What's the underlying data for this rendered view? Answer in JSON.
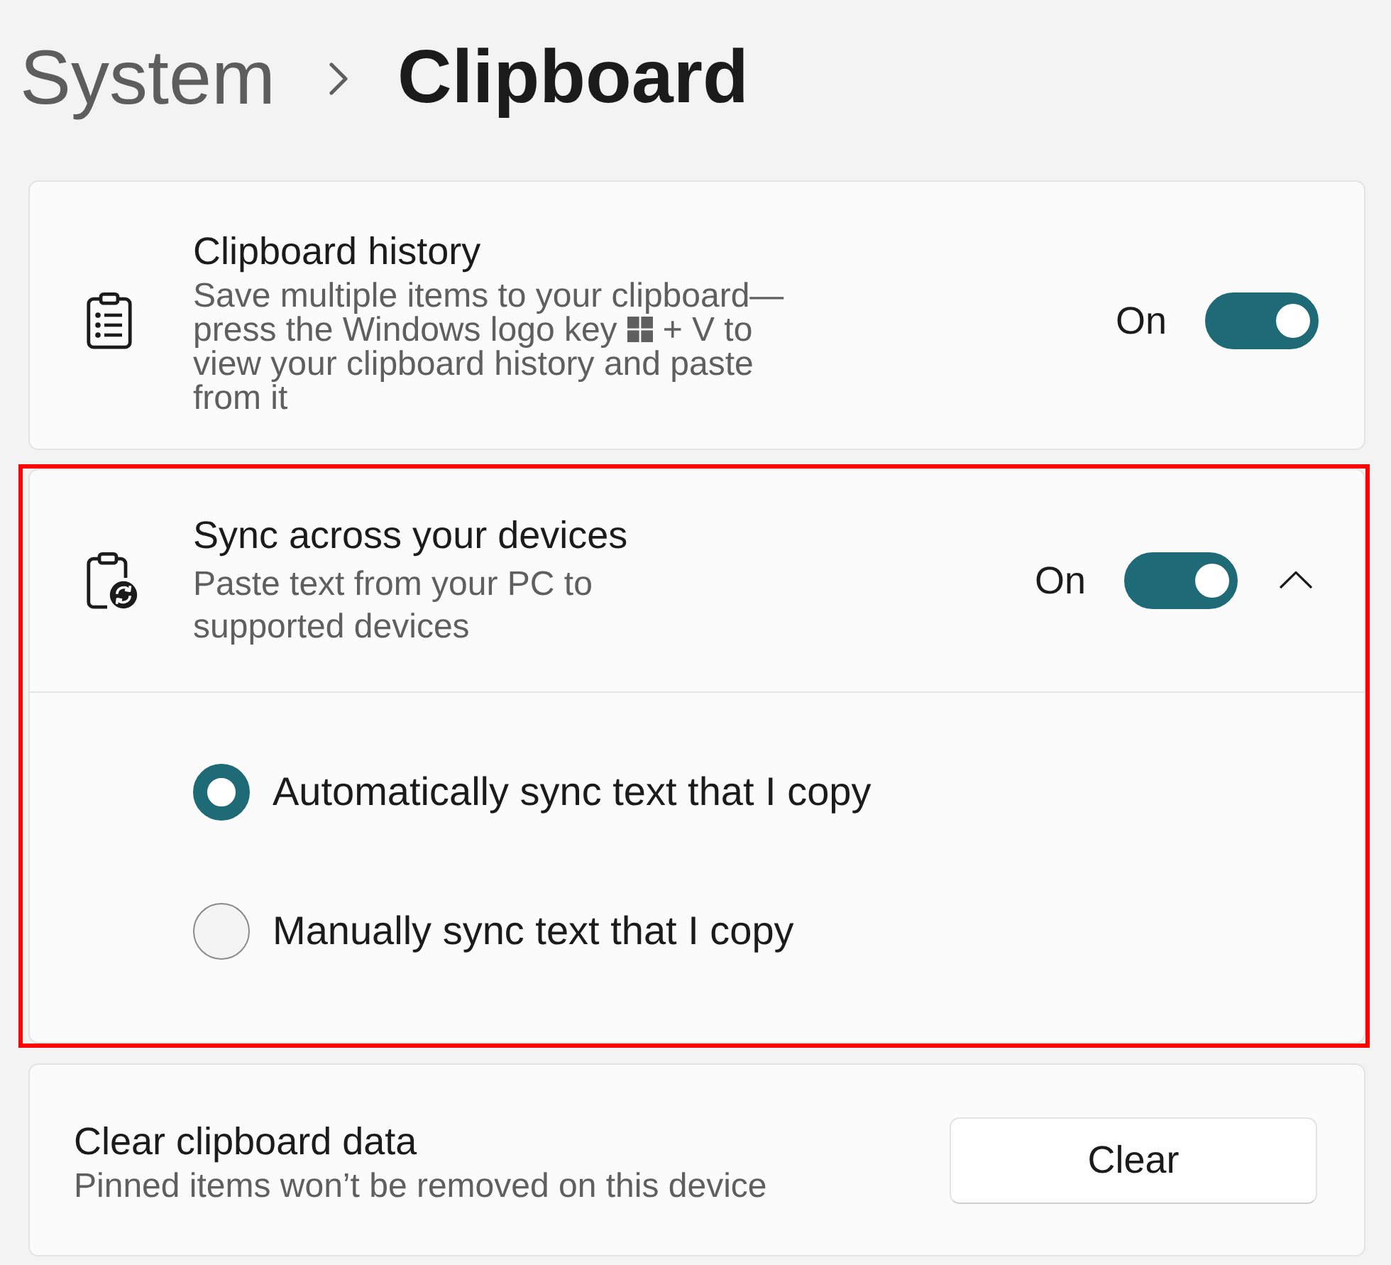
{
  "breadcrumb": {
    "parent": "System",
    "current": "Clipboard"
  },
  "clipboard_history": {
    "title": "Clipboard history",
    "description_before_key": "Save multiple items to your clipboard—press the Windows logo key",
    "description_after_key": "+ V to view your clipboard history and paste from it",
    "state_label": "On",
    "on": true
  },
  "sync": {
    "highlighted": true,
    "title": "Sync across your devices",
    "description": "Paste text from your PC to supported devices",
    "state_label": "On",
    "on": true,
    "expanded": true,
    "options": [
      {
        "label": "Automatically sync text that I copy",
        "selected": true
      },
      {
        "label": "Manually sync text that I copy",
        "selected": false
      }
    ]
  },
  "clear_data": {
    "title": "Clear clipboard data",
    "description": "Pinned items won’t be removed on this device",
    "button": "Clear"
  }
}
